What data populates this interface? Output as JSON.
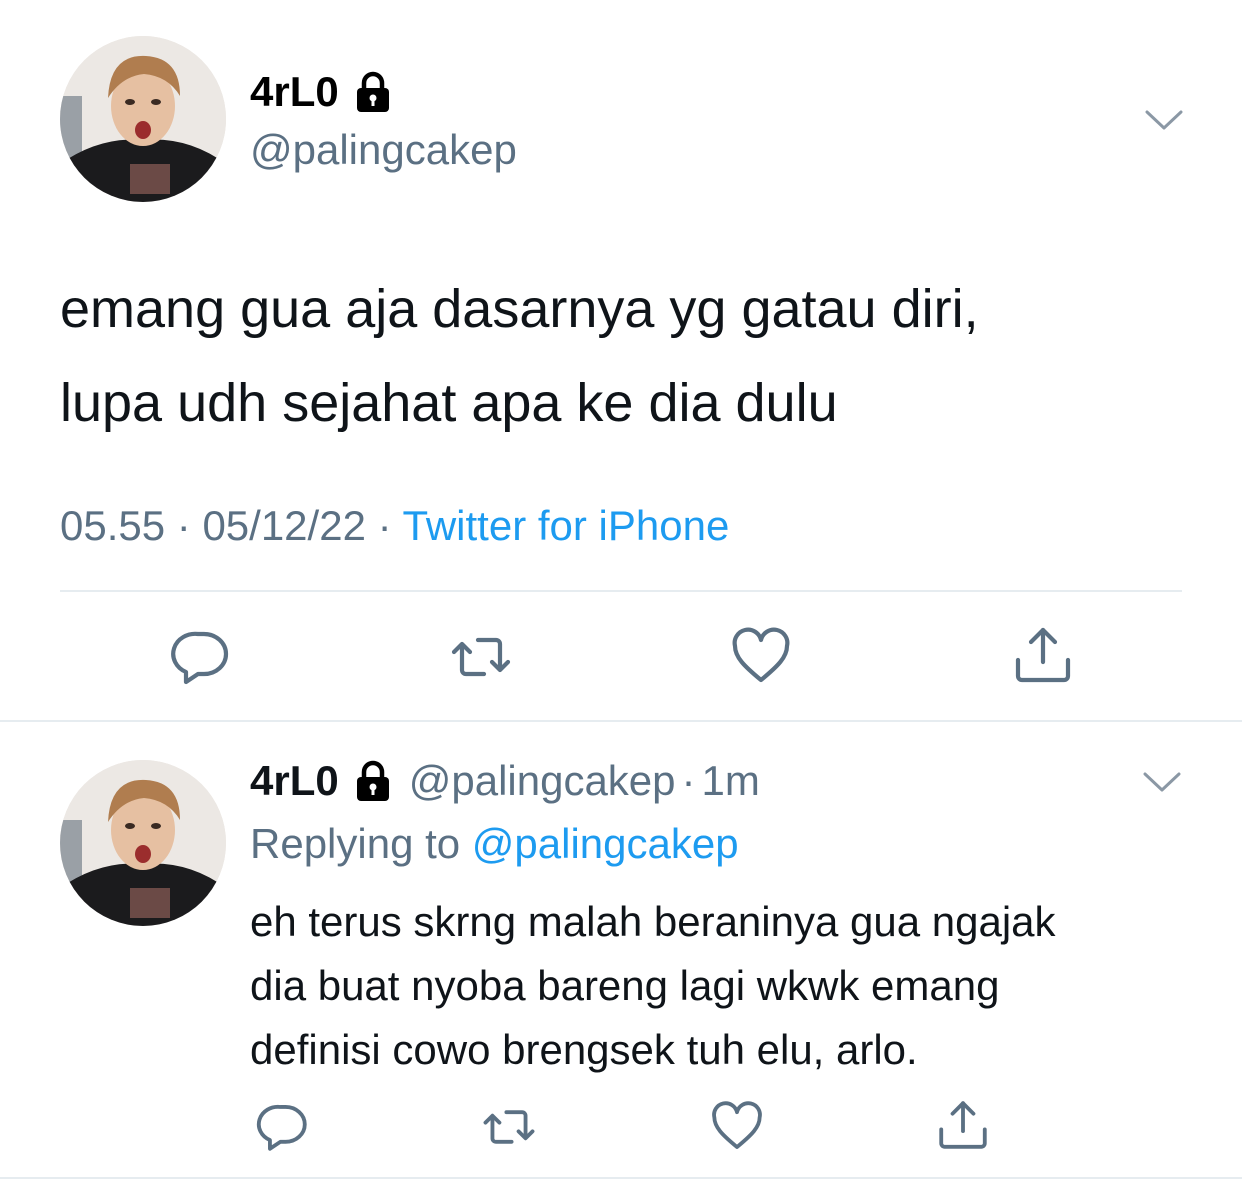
{
  "main_tweet": {
    "display_name": "4rL0",
    "handle": "@palingcakep",
    "text_line1": "emang gua aja dasarnya yg gatau diri,",
    "text_line2": "lupa udh sejahat apa ke dia dulu",
    "time": "05.55",
    "separator": "·",
    "date": "05/12/22",
    "source": "Twitter for iPhone"
  },
  "reply_tweet": {
    "display_name": "4rL0",
    "handle": "@palingcakep",
    "separator": "·",
    "time_ago": "1m",
    "replying_prefix": "Replying to ",
    "replying_to": "@palingcakep",
    "text_line1": "eh terus skrng malah beraninya gua ngajak",
    "text_line2": "dia buat nyoba bareng lagi wkwk emang",
    "text_line3": "definisi cowo brengsek tuh elu, arlo."
  },
  "icons": {
    "reply": "reply-icon",
    "retweet": "retweet-icon",
    "like": "heart-icon",
    "share": "share-icon",
    "protected": "lock-icon",
    "more": "chevron-down-icon"
  },
  "colors": {
    "text": "#0f1419",
    "secondary": "#5b7083",
    "link": "#1d9bf0",
    "divider": "#e6ecf0"
  }
}
